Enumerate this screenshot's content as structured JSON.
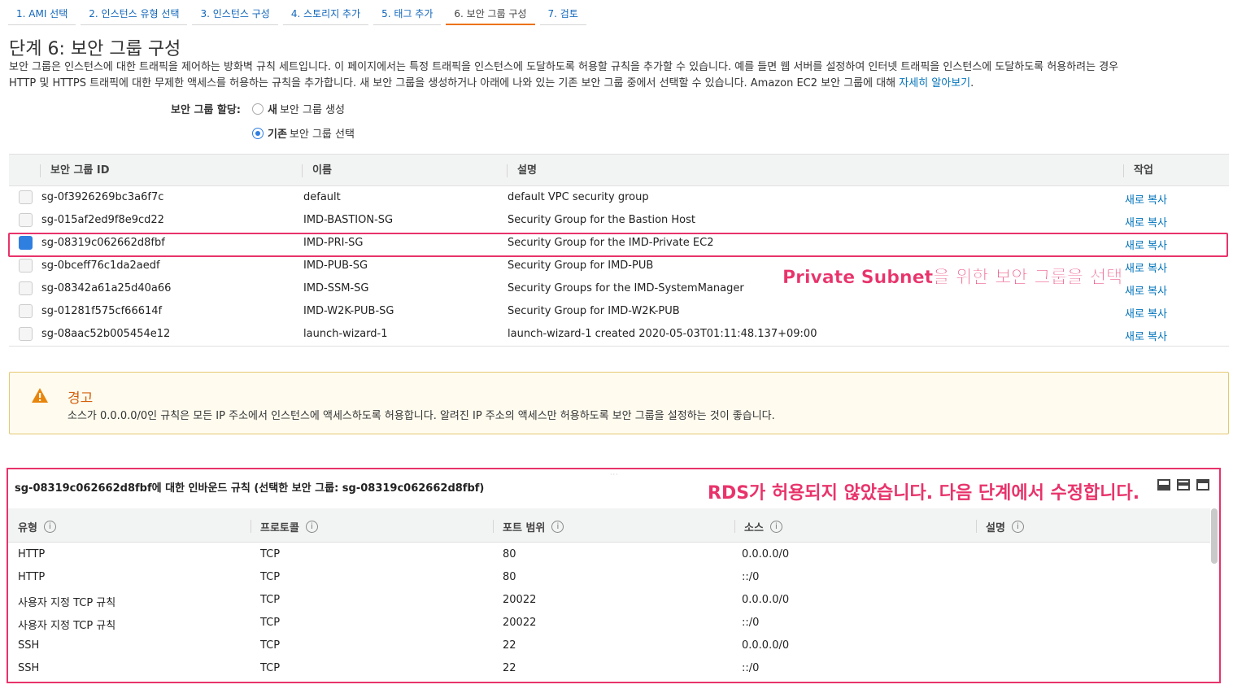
{
  "tabs": [
    {
      "label": "1. AMI 선택"
    },
    {
      "label": "2. 인스턴스 유형 선택"
    },
    {
      "label": "3. 인스턴스 구성"
    },
    {
      "label": "4. 스토리지 추가"
    },
    {
      "label": "5. 태그 추가"
    },
    {
      "label": "6. 보안 그룹 구성"
    },
    {
      "label": "7. 검토"
    }
  ],
  "page": {
    "title": "단계 6: 보안 그룹 구성",
    "description_line1": "보안 그룹은 인스턴스에 대한 트래픽을 제어하는 방화벽 규칙 세트입니다. 이 페이지에서는 특정 트래픽을 인스턴스에 도달하도록 허용할 규칙을 추가할 수 있습니다. 예를 들면 웹 서버를 설정하여 인터넷 트래픽을 인스턴스에 도달하도록 허용하려는 경우",
    "description_line2": "HTTP 및 HTTPS 트래픽에 대한 무제한 액세스를 허용하는 규칙을 추가합니다. 새 보안 그룹을 생성하거나 아래에 나와 있는 기존 보안 그룹 중에서 선택할 수 있습니다. Amazon EC2 보안 그룹에 대해",
    "learn_more": "자세히 알아보기",
    "learn_more_suffix": "."
  },
  "assign": {
    "label": "보안 그룹 할당:",
    "option_new_bold": "새",
    "option_new_rest": "보안 그룹 생성",
    "option_existing_bold": "기존",
    "option_existing_rest": "보안 그룹 선택",
    "selected": "existing"
  },
  "sg_table": {
    "headers": {
      "id": "보안 그룹 ID",
      "name": "이름",
      "desc": "설명",
      "action": "작업"
    },
    "rows": [
      {
        "id": "sg-0f3926269bc3a6f7c",
        "name": "default",
        "desc": "default VPC security group",
        "action": "새로 복사",
        "checked": false
      },
      {
        "id": "sg-015af2ed9f8e9cd22",
        "name": "IMD-BASTION-SG",
        "desc": "Security Group for the Bastion Host",
        "action": "새로 복사",
        "checked": false
      },
      {
        "id": "sg-08319c062662d8fbf",
        "name": "IMD-PRI-SG",
        "desc": "Security Group for the IMD-Private EC2",
        "action": "새로 복사",
        "checked": true
      },
      {
        "id": "sg-0bceff76c1da2aedf",
        "name": "IMD-PUB-SG",
        "desc": "Security Group for IMD-PUB",
        "action": "새로 복사",
        "checked": false
      },
      {
        "id": "sg-08342a61a25d40a66",
        "name": "IMD-SSM-SG",
        "desc": "Security Groups for the IMD-SystemManager",
        "action": "새로 복사",
        "checked": false
      },
      {
        "id": "sg-01281f575cf66614f",
        "name": "IMD-W2K-PUB-SG",
        "desc": "Security Group for IMD-W2K-PUB",
        "action": "새로 복사",
        "checked": false
      },
      {
        "id": "sg-08aac52b005454e12",
        "name": "launch-wizard-1",
        "desc": "launch-wizard-1 created 2020-05-03T01:11:48.137+09:00",
        "action": "새로 복사",
        "checked": false
      }
    ]
  },
  "annotations": {
    "select_note": "Private Subnet을 위한 보안 그룹을 선택",
    "rds_note": "RDS가 허용되지 않았습니다. 다음 단계에서 수정합니다."
  },
  "warning": {
    "title": "경고",
    "text": "소스가 0.0.0.0/0인 규칙은 모든 IP 주소에서 인스턴스에 액세스하도록 허용합니다. 알려진 IP 주소의 액세스만 허용하도록 보안 그룹을 설정하는 것이 좋습니다."
  },
  "inbound": {
    "title": "sg-08319c062662d8fbf에 대한 인바운드 규칙 (선택한 보안 그룹: sg-08319c062662d8fbf)",
    "handle": "···",
    "headers": {
      "type": "유형",
      "protocol": "프로토콜",
      "port": "포트 범위",
      "source": "소스",
      "desc": "설명"
    },
    "info_glyph": "i",
    "rows": [
      {
        "type": "HTTP",
        "protocol": "TCP",
        "port": "80",
        "source": "0.0.0.0/0",
        "desc": ""
      },
      {
        "type": "HTTP",
        "protocol": "TCP",
        "port": "80",
        "source": "::/0",
        "desc": ""
      },
      {
        "type": "사용자 지정 TCP 규칙",
        "protocol": "TCP",
        "port": "20022",
        "source": "0.0.0.0/0",
        "desc": ""
      },
      {
        "type": "사용자 지정 TCP 규칙",
        "protocol": "TCP",
        "port": "20022",
        "source": "::/0",
        "desc": ""
      },
      {
        "type": "SSH",
        "protocol": "TCP",
        "port": "22",
        "source": "0.0.0.0/0",
        "desc": ""
      },
      {
        "type": "SSH",
        "protocol": "TCP",
        "port": "22",
        "source": "::/0",
        "desc": ""
      }
    ]
  },
  "colors": {
    "accent": "#ec7211",
    "link": "#0073bb",
    "annotation": "#e8336b",
    "warning": "#d4600c"
  },
  "icons": {
    "warning": "warning-triangle-icon",
    "info": "info-icon"
  }
}
